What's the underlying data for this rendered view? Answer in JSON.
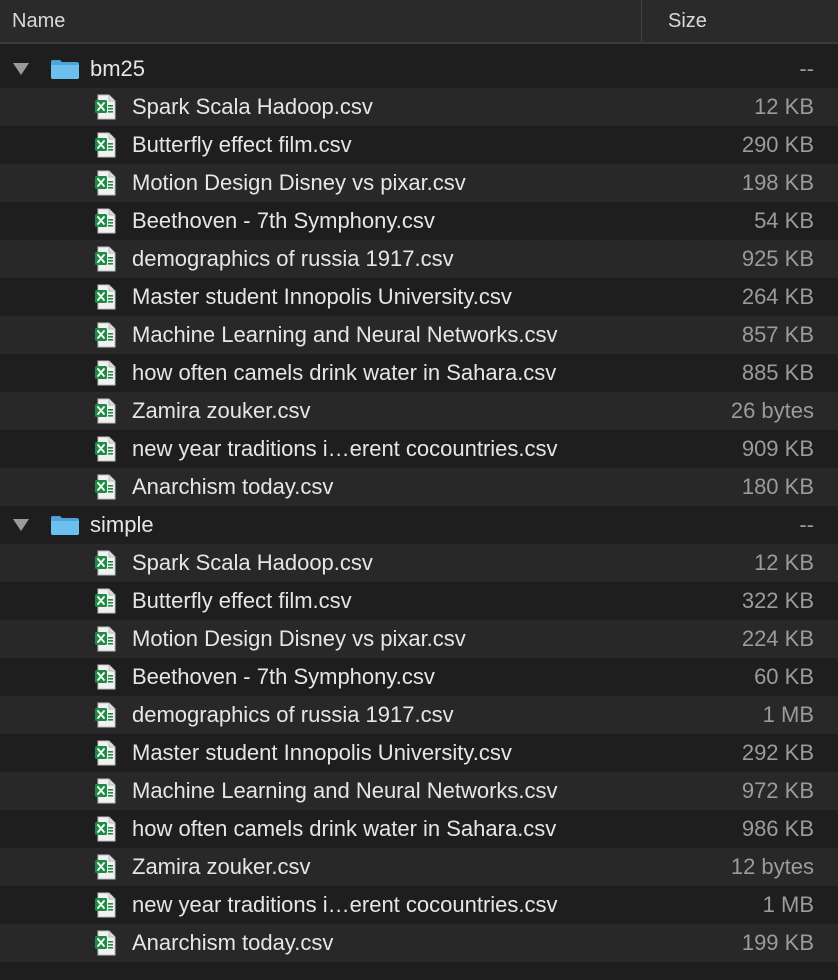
{
  "header": {
    "name_label": "Name",
    "size_label": "Size"
  },
  "folders": [
    {
      "name": "bm25",
      "size": "--",
      "files": [
        {
          "name": "Spark Scala Hadoop.csv",
          "size": "12 KB"
        },
        {
          "name": "Butterfly effect film.csv",
          "size": "290 KB"
        },
        {
          "name": "Motion Design Disney vs pixar.csv",
          "size": "198 KB"
        },
        {
          "name": "Beethoven - 7th Symphony.csv",
          "size": "54 KB"
        },
        {
          "name": "demographics of russia 1917.csv",
          "size": "925 KB"
        },
        {
          "name": "Master student Innopolis University.csv",
          "size": "264 KB"
        },
        {
          "name": "Machine Learning and Neural Networks.csv",
          "size": "857 KB"
        },
        {
          "name": "how often camels drink water in Sahara.csv",
          "size": "885 KB"
        },
        {
          "name": "Zamira zouker.csv",
          "size": "26 bytes"
        },
        {
          "name": "new year traditions i…erent cocountries.csv",
          "size": "909 KB"
        },
        {
          "name": "Anarchism today.csv",
          "size": "180 KB"
        }
      ]
    },
    {
      "name": "simple",
      "size": "--",
      "files": [
        {
          "name": "Spark Scala Hadoop.csv",
          "size": "12 KB"
        },
        {
          "name": "Butterfly effect film.csv",
          "size": "322 KB"
        },
        {
          "name": "Motion Design Disney vs pixar.csv",
          "size": "224 KB"
        },
        {
          "name": "Beethoven - 7th Symphony.csv",
          "size": "60 KB"
        },
        {
          "name": "demographics of russia 1917.csv",
          "size": "1 MB"
        },
        {
          "name": "Master student Innopolis University.csv",
          "size": "292 KB"
        },
        {
          "name": "Machine Learning and Neural Networks.csv",
          "size": "972 KB"
        },
        {
          "name": "how often camels drink water in Sahara.csv",
          "size": "986 KB"
        },
        {
          "name": "Zamira zouker.csv",
          "size": "12 bytes"
        },
        {
          "name": "new year traditions i…erent cocountries.csv",
          "size": "1 MB"
        },
        {
          "name": "Anarchism today.csv",
          "size": "199 KB"
        }
      ]
    }
  ],
  "icons": {
    "folder": "folder-icon",
    "file": "excel-csv-file-icon",
    "disclosure": "disclosure-triangle-down-icon"
  },
  "colors": {
    "folder_blue": "#5fb3e6",
    "excel_green": "#1e8c45"
  }
}
